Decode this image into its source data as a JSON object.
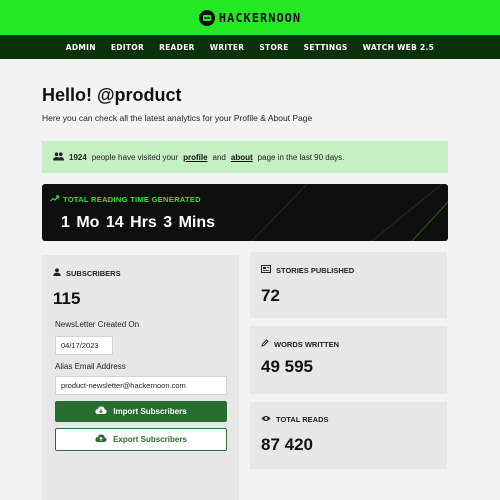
{
  "header": {
    "brand": "HACKERNOON"
  },
  "nav": {
    "items": [
      "ADMIN",
      "EDITOR",
      "READER",
      "WRITER",
      "STORE",
      "SETTINGS",
      "WATCH WEB 2.5"
    ]
  },
  "greeting": {
    "title": "Hello! @product",
    "subtitle": "Here you can check all the latest analytics for your Profile & About Page"
  },
  "visits": {
    "count": "1924",
    "text_before": "people have visited your",
    "profile_link": "profile",
    "and": "and",
    "about_link": "about",
    "text_after": "page in the last 90 days."
  },
  "reading_time": {
    "label": "TOTAL READING TIME GENERATED",
    "value": "1 Mo  14 Hrs  3 Mins"
  },
  "subscribers": {
    "label": "SUBSCRIBERS",
    "count": "115",
    "newsletter_label": "NewsLetter Created On",
    "newsletter_date": "04/17/2023",
    "alias_label": "Alias Email Address",
    "alias_email": "product-newsletter@hackernoon.com",
    "import_label": "Import Subscribers",
    "export_label": "Export Subscribers"
  },
  "stories": {
    "label": "STORIES PUBLISHED",
    "count": "72"
  },
  "words": {
    "label": "WORDS WRITTEN",
    "count": "49 595"
  },
  "reads": {
    "label": "TOTAL READS",
    "count": "87 420"
  },
  "colors": {
    "brand_green": "#25e825",
    "nav_dark": "#0c320c",
    "button_green": "#2a6e2f",
    "accent_green": "#35e035",
    "banner_bg": "#c5f0c3"
  },
  "icons": [
    "hackernoon-helmet-icon",
    "users-icon",
    "trend-up-icon",
    "user-icon",
    "newspaper-icon",
    "pencil-icon",
    "eye-icon",
    "cloud-download-icon",
    "cloud-upload-icon"
  ]
}
